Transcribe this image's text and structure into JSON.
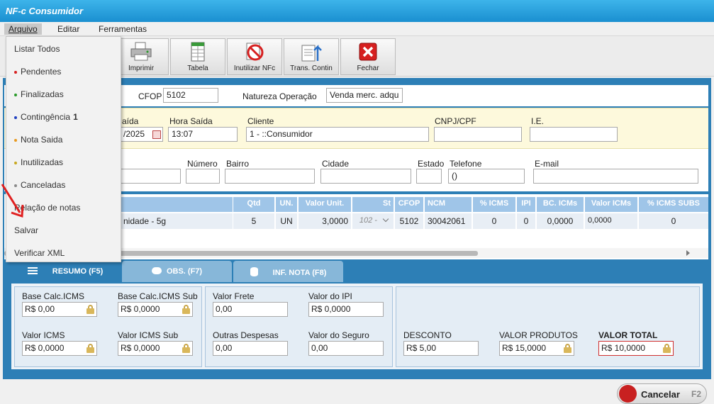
{
  "window": {
    "title": "NF-c Consumidor"
  },
  "menu": [
    "Arquivo",
    "Editar",
    "Ferramentas"
  ],
  "toolbar": [
    {
      "label": "Imprimir",
      "icon": "printer-icon"
    },
    {
      "label": "Tabela",
      "icon": "spreadsheet-icon"
    },
    {
      "label": "Inutilizar NFc",
      "icon": "cancel-document-icon"
    },
    {
      "label": "Trans. Contin",
      "icon": "transfer-icon"
    },
    {
      "label": "Fechar",
      "icon": "close-icon"
    }
  ],
  "arquivo_menu": [
    {
      "label": "Listar Todos",
      "dot": ""
    },
    {
      "label": "Pendentes",
      "dot": "#d62020"
    },
    {
      "label": "Finalizadas",
      "dot": "#2a9a2a"
    },
    {
      "label": "Contingência",
      "dot": "#2040c0",
      "badge": "1"
    },
    {
      "label": "Nota Saida",
      "dot": "#e89a20"
    },
    {
      "label": "Inutilizadas",
      "dot": "#c8a820"
    },
    {
      "label": "Canceladas",
      "dot": "#8a8a8a"
    },
    {
      "label": "Relação de notas",
      "dot": ""
    },
    {
      "label": "Salvar",
      "dot": ""
    },
    {
      "label": "Verificar XML",
      "dot": ""
    }
  ],
  "header": {
    "cfop_label": "CFOP",
    "cfop_value": "5102",
    "natureza_label": "Natureza Operação",
    "natureza_value": "Venda merc. adqu",
    "saida_label": "aída",
    "saida_value": "/2025",
    "hora_label": "Hora Saída",
    "hora_value": "13:07",
    "cliente_label": "Cliente",
    "cliente_value": "1 - ::Consumidor",
    "cnpj_label": "CNPJ/CPF",
    "cnpj_value": "",
    "ie_label": "I.E.",
    "ie_value": ""
  },
  "address": {
    "numero_label": "Número",
    "bairro_label": "Bairro",
    "cidade_label": "Cidade",
    "estado_label": "Estado",
    "telefone_label": "Telefone",
    "telefone_value": "()",
    "email_label": "E-mail"
  },
  "grid": {
    "columns": [
      "Qtd",
      "UN.",
      "Valor Unit.",
      "St",
      "CFOP",
      "NCM",
      "% ICMS",
      "IPI",
      "BC. ICMs",
      "Valor ICMs",
      "% ICMS SUBS"
    ],
    "row": {
      "descricao": "nidade - 5g",
      "qtd": "5",
      "un": "UN",
      "valor_unit": "3,0000",
      "st": "102 -",
      "cfop": "5102",
      "ncm": "30042061",
      "icms": "0",
      "ipi": "0",
      "bc_icms": "0,0000",
      "valor_icms": "0,0000",
      "icms_subs": "0"
    }
  },
  "tabs": [
    {
      "label": "RESUMO (F5)",
      "icon": "list-icon"
    },
    {
      "label": "OBS. (F7)",
      "icon": "comment-icon"
    },
    {
      "label": "INF. NOTA (F8)",
      "icon": "database-icon"
    }
  ],
  "resumo": {
    "base_calc_icms_label": "Base Calc.ICMS",
    "base_calc_icms": "R$ 0,00",
    "base_calc_icms_sub_label": "Base Calc.ICMS Sub",
    "base_calc_icms_sub": "R$ 0,0000",
    "valor_icms_label": "Valor ICMS",
    "valor_icms": "R$ 0,0000",
    "valor_icms_sub_label": "Valor ICMS Sub",
    "valor_icms_sub": "R$ 0,0000",
    "valor_frete_label": "Valor Frete",
    "valor_frete": "0,00",
    "valor_ipi_label": "Valor do IPI",
    "valor_ipi": "R$ 0,0000",
    "outras_despesas_label": "Outras Despesas",
    "outras_despesas": "0,00",
    "valor_seguro_label": "Valor do Seguro",
    "valor_seguro": "0,00",
    "desconto_label": "DESCONTO",
    "desconto": "R$ 5,00",
    "valor_produtos_label": "VALOR PRODUTOS",
    "valor_produtos": "R$ 15,0000",
    "valor_total_label": "VALOR TOTAL",
    "valor_total": "R$ 10,0000"
  },
  "footer": {
    "cancel_label": "Cancelar",
    "cancel_shortcut": "F2"
  },
  "colors": {
    "accent": "#2d7fb6",
    "title": "#1a8fd0",
    "total_border": "#d03030"
  }
}
